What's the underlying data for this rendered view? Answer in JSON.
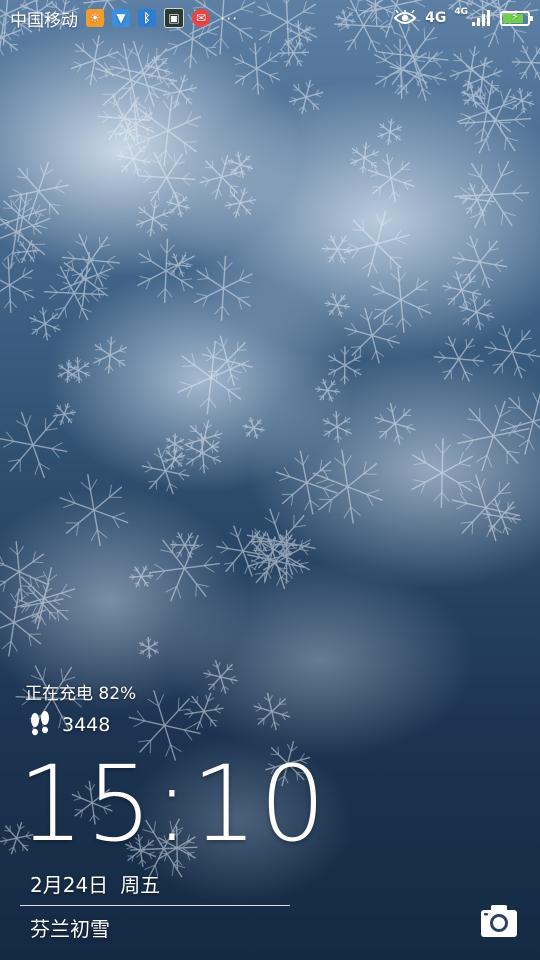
{
  "status_bar": {
    "carrier": "中国移动",
    "notification_icons": [
      "weather-app-icon",
      "store-app-icon",
      "bluetooth-app-icon",
      "photo-app-icon",
      "message-app-icon"
    ],
    "more_label": "···",
    "network_small": "4G",
    "network_label": "4G",
    "battery_level": 0.82,
    "charging": true
  },
  "lock_screen": {
    "charge_status": "正在充电 82%",
    "steps_icon": "footsteps-icon",
    "steps": "3448",
    "time": "15:10",
    "date": "2月24日",
    "weekday": "周五",
    "wallpaper_title": "芬兰初雪",
    "camera_icon": "camera-icon"
  },
  "colors": {
    "battery_green": "#6fd04a",
    "text": "#ffffff"
  }
}
